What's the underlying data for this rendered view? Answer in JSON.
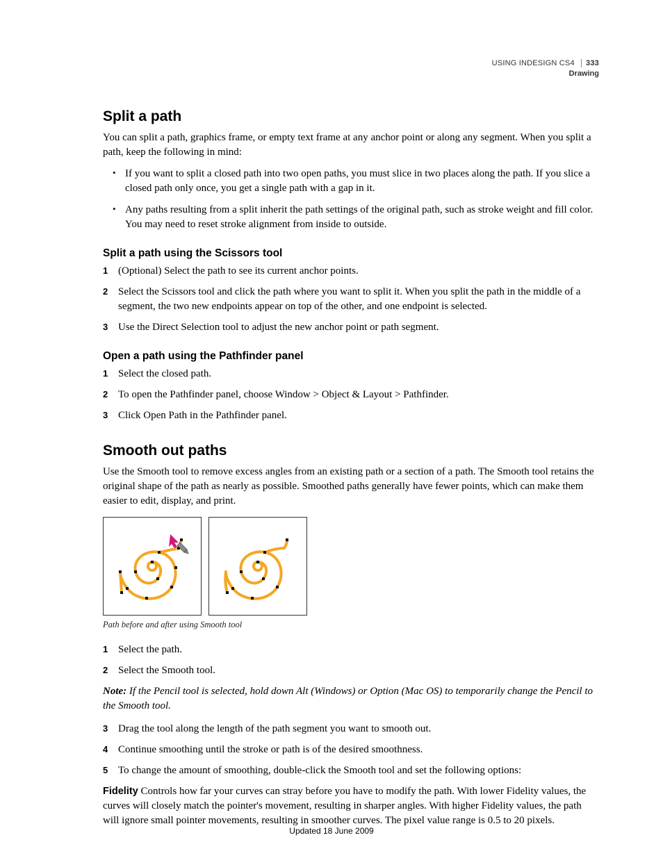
{
  "header": {
    "doc_title": "USING INDESIGN CS4",
    "section": "Drawing",
    "page_number": "333"
  },
  "h2_1": "Split a path",
  "p1": "You can split a path, graphics frame, or empty text frame at any anchor point or along any segment. When you split a path, keep the following in mind:",
  "bullets1": [
    "If you want to split a closed path into two open paths, you must slice in two places along the path. If you slice a closed path only once, you get a single path with a gap in it.",
    "Any paths resulting from a split inherit the path settings of the original path, such as stroke weight and fill color. You may need to reset stroke alignment from inside to outside."
  ],
  "h3_1": "Split a path using the Scissors tool",
  "steps1": [
    "(Optional) Select the path to see its current anchor points.",
    "Select the Scissors tool and click the path where you want to split it. When you split the path in the middle of a segment, the two new endpoints appear on top of the other, and one endpoint is selected.",
    "Use the Direct Selection tool to adjust the new anchor point or path segment."
  ],
  "h3_2": "Open a path using the Pathfinder panel",
  "steps2": [
    "Select the closed path.",
    "To open the Pathfinder panel, choose Window > Object & Layout > Pathfinder.",
    "Click Open Path in the Pathfinder panel."
  ],
  "h2_2": "Smooth out paths",
  "p2": "Use the Smooth tool to remove excess angles from an existing path or a section of a path. The Smooth tool retains the original shape of the path as nearly as possible. Smoothed paths generally have fewer points, which can make them easier to edit, display, and print.",
  "figcaption": "Path before and after using Smooth tool",
  "steps3a": [
    "Select the path.",
    "Select the Smooth tool."
  ],
  "note_label": "Note:",
  "note_text": " If the Pencil tool is selected, hold down Alt (Windows) or Option (Mac OS) to temporarily change the Pencil to the Smooth tool.",
  "steps3b": [
    "Drag the tool along the length of the path segment you want to smooth out.",
    "Continue smoothing until the stroke or path is of the desired smoothness.",
    "To change the amount of smoothing, double-click the Smooth tool and set the following options:"
  ],
  "def_label": "Fidelity",
  "def_text": "  Controls how far your curves can stray before you have to modify the path. With lower Fidelity values, the curves will closely match the pointer's movement, resulting in sharper angles. With higher Fidelity values, the path will ignore small pointer movements, resulting in smoother curves. The pixel value range is 0.5 to 20 pixels.",
  "footer": "Updated 18 June 2009"
}
